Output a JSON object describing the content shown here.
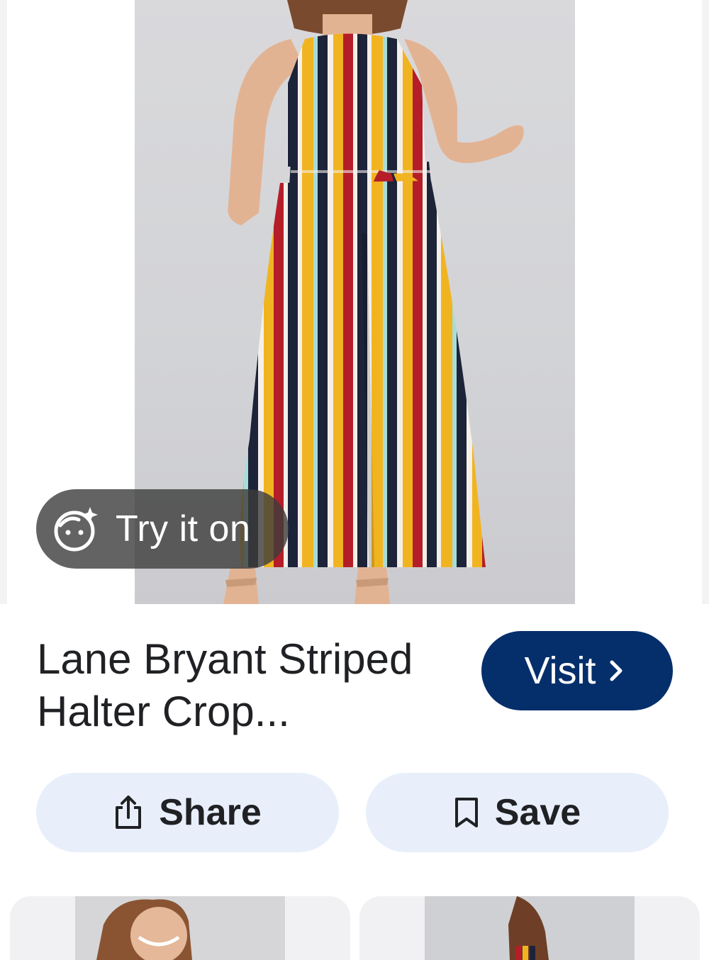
{
  "hero": {
    "image_subject": "model-in-striped-halter-jumpsuit",
    "try_on_label": "Try it on",
    "try_on_icon": "face-sparkle-icon"
  },
  "product": {
    "title": "Lane Bryant Striped Halter Crop...",
    "visit_label": "Visit",
    "visit_icon": "chevron-right-icon"
  },
  "actions": {
    "share_label": "Share",
    "share_icon": "share-icon",
    "save_label": "Save",
    "save_icon": "bookmark-icon"
  },
  "related": {
    "items": [
      "related-result-1",
      "related-result-2"
    ]
  },
  "colors": {
    "visit_bg": "#052f6b",
    "action_bg": "#e8effb",
    "stripe_red": "#b51e28",
    "stripe_yellow": "#f1b421",
    "stripe_navy": "#1d2338",
    "stripe_mint": "#a8dcd8",
    "stripe_white": "#f4efe9"
  }
}
